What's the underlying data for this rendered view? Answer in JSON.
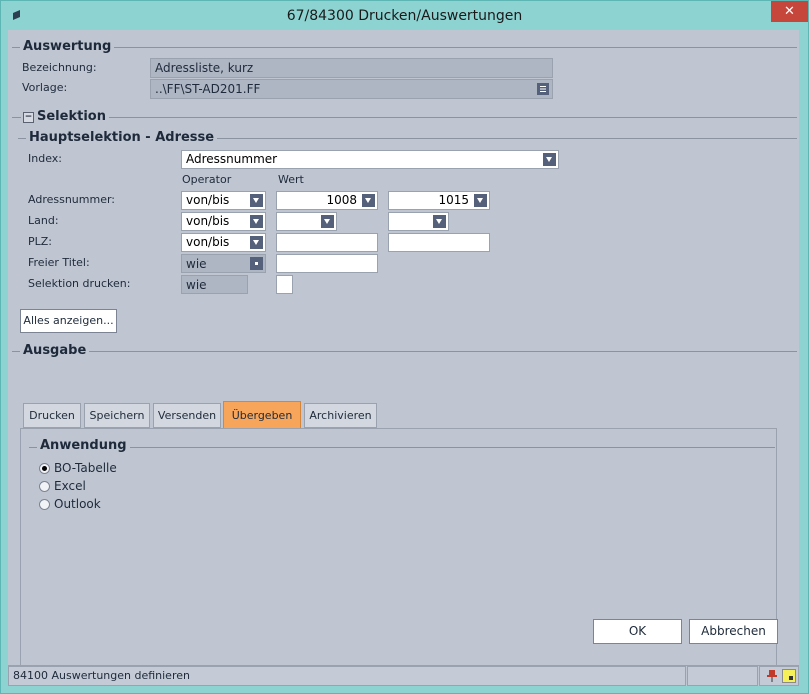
{
  "window": {
    "title": "67/84300 Drucken/Auswertungen",
    "close_glyph": "✕"
  },
  "auswertung": {
    "title": "Auswertung",
    "bezeichnung_label": "Bezeichnung:",
    "bezeichnung_value": "Adressliste, kurz",
    "vorlage_label": "Vorlage:",
    "vorlage_value": "..\\FF\\ST-AD201.FF"
  },
  "selektion": {
    "title": "Selektion",
    "toggle": "−"
  },
  "hauptselektion": {
    "title": "Hauptselektion - Adresse",
    "index_label": "Index:",
    "index_value": "Adressnummer",
    "operator_header": "Operator",
    "wert_header": "Wert",
    "rows": [
      {
        "label": "Adressnummer:",
        "operator": "von/bis",
        "von": "1008",
        "bis": "1015"
      },
      {
        "label": "Land:",
        "operator": "von/bis",
        "von": "",
        "bis": ""
      },
      {
        "label": "PLZ:",
        "operator": "von/bis",
        "von": "",
        "bis": ""
      },
      {
        "label": "Freier Titel:",
        "operator": "wie",
        "von": ""
      },
      {
        "label": "Selektion drucken:",
        "operator": "wie"
      }
    ],
    "alles_button": "Alles anzeigen..."
  },
  "ausgabe": {
    "title": "Ausgabe",
    "tabs": [
      "Drucken",
      "Speichern",
      "Versenden",
      "Übergeben",
      "Archivieren"
    ],
    "active_tab": "Übergeben",
    "anwendung_title": "Anwendung",
    "options": [
      "BO-Tabelle",
      "Excel",
      "Outlook"
    ],
    "selected_option": "BO-Tabelle"
  },
  "buttons": {
    "ok": "OK",
    "cancel": "Abbrechen"
  },
  "statusbar": {
    "text": "84100 Auswertungen definieren"
  },
  "colors": {
    "accent_tab": "#f6a55b",
    "window_frame": "#8dd3d1",
    "close": "#c7463c",
    "background": "#bfc6d2"
  }
}
